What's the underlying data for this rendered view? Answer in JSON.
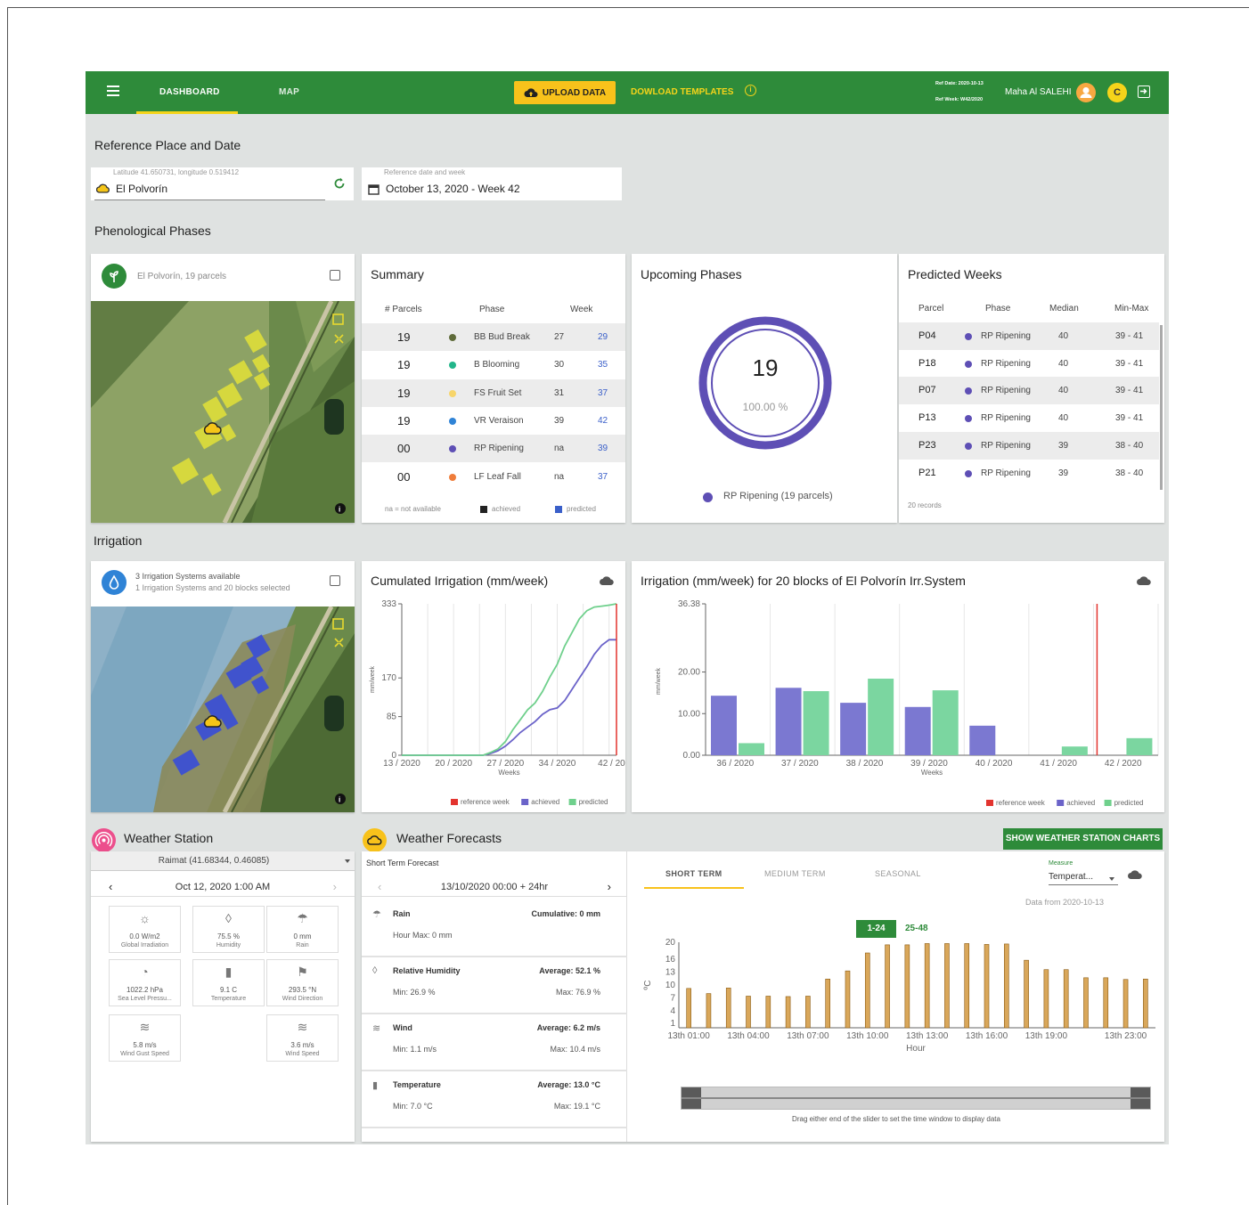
{
  "topbar": {
    "tabs": [
      "DASHBOARD",
      "MAP"
    ],
    "upload_label": "UPLOAD DATA",
    "download_label": "DOWLOAD TEMPLATES",
    "ref_date": "Ref Date: 2020-10-13",
    "ref_week": "Ref Week: W42/2020",
    "user_name": "Maha Al SALEHI",
    "badge": "C"
  },
  "reference": {
    "title": "Reference Place and Date",
    "place_label": "Latitude 41.650731, longitude 0.519412",
    "place_value": "El Polvorín",
    "date_label": "Reference date and week",
    "date_value": "October 13, 2020 - Week 42"
  },
  "phenology": {
    "title": "Phenological Phases",
    "map_caption": "El Polvorín, 19 parcels",
    "summary": {
      "title": "Summary",
      "headers": [
        "# Parcels",
        "Phase",
        "Week"
      ],
      "rows": [
        {
          "parcels": "19",
          "phase": "BB Bud Break",
          "achieved": "27",
          "predicted": "29",
          "color": "#5f6b3a"
        },
        {
          "parcels": "19",
          "phase": "B Blooming",
          "achieved": "30",
          "predicted": "35",
          "color": "#22b58a"
        },
        {
          "parcels": "19",
          "phase": "FS Fruit Set",
          "achieved": "31",
          "predicted": "37",
          "color": "#f7d56b"
        },
        {
          "parcels": "19",
          "phase": "VR Veraison",
          "achieved": "39",
          "predicted": "42",
          "color": "#2f83d6"
        },
        {
          "parcels": "00",
          "phase": "RP Ripening",
          "achieved": "na",
          "predicted": "39",
          "color": "#5e4fb5"
        },
        {
          "parcels": "00",
          "phase": "LF Leaf Fall",
          "achieved": "na",
          "predicted": "37",
          "color": "#ef7d3b"
        }
      ],
      "footer_na": "na = not available",
      "footer_achieved": "achieved",
      "footer_predicted": "predicted"
    },
    "upcoming": {
      "title": "Upcoming Phases",
      "count": "19",
      "percent": "100.00 %",
      "legend": "RP Ripening (19 parcels)",
      "color": "#5e4fb5"
    },
    "predicted": {
      "title": "Predicted Weeks",
      "headers": [
        "Parcel",
        "Phase",
        "Median",
        "Min-Max"
      ],
      "rows": [
        {
          "parcel": "P04",
          "phase": "RP Ripening",
          "median": "40",
          "minmax": "39 - 41"
        },
        {
          "parcel": "P18",
          "phase": "RP Ripening",
          "median": "40",
          "minmax": "39 - 41"
        },
        {
          "parcel": "P07",
          "phase": "RP Ripening",
          "median": "40",
          "minmax": "39 - 41"
        },
        {
          "parcel": "P13",
          "phase": "RP Ripening",
          "median": "40",
          "minmax": "39 - 41"
        },
        {
          "parcel": "P23",
          "phase": "RP Ripening",
          "median": "39",
          "minmax": "38 - 40"
        },
        {
          "parcel": "P21",
          "phase": "RP Ripening",
          "median": "39",
          "minmax": "38 - 40"
        }
      ],
      "footer": "20 records"
    }
  },
  "irrigation": {
    "title": "Irrigation",
    "map_caption_1": "3 Irrigation Systems available",
    "map_caption_2": "1 Irrigation Systems and 20 blocks selected",
    "cumulated_title": "Cumulated Irrigation (mm/week)",
    "blocks_title": "Irrigation (mm/week) for 20 blocks of El Polvorín Irr.System",
    "legend": [
      "reference week",
      "achieved",
      "predicted"
    ]
  },
  "chart_data": [
    {
      "type": "line",
      "title": "Cumulated Irrigation (mm/week)",
      "xlabel": "Weeks",
      "ylabel": "mm/week",
      "x_ticks": [
        "13 / 2020",
        "20 / 2020",
        "27 / 2020",
        "34 / 2020",
        "42 / 2020"
      ],
      "y_ticks": [
        0,
        85,
        170,
        333
      ],
      "xlim": [
        13,
        42
      ],
      "ylim": [
        0,
        333
      ],
      "reference_week": 42,
      "series": [
        {
          "name": "achieved",
          "color": "#6b63c9",
          "x": [
            13,
            24,
            25,
            26,
            27,
            28,
            29,
            30,
            31,
            32,
            33,
            34,
            35,
            36,
            37,
            38,
            39,
            40,
            41,
            42
          ],
          "values": [
            0,
            0,
            4,
            10,
            20,
            34,
            50,
            62,
            74,
            90,
            100,
            104,
            120,
            145,
            170,
            195,
            222,
            242,
            254,
            254
          ]
        },
        {
          "name": "predicted",
          "color": "#6fd08c",
          "x": [
            13,
            24,
            25,
            26,
            27,
            28,
            29,
            30,
            31,
            32,
            33,
            34,
            35,
            36,
            37,
            38,
            39,
            40,
            41,
            42
          ],
          "values": [
            0,
            0,
            6,
            14,
            30,
            56,
            78,
            100,
            115,
            140,
            172,
            200,
            240,
            270,
            300,
            318,
            326,
            328,
            330,
            333
          ]
        }
      ],
      "legend": [
        "reference week",
        "achieved",
        "predicted"
      ]
    },
    {
      "type": "bar",
      "title": "Irrigation (mm/week) for 20 blocks of El Polvorín Irr.System",
      "xlabel": "Weeks",
      "ylabel": "mm/week",
      "categories": [
        "36 / 2020",
        "37 / 2020",
        "38 / 2020",
        "39 / 2020",
        "40 / 2020",
        "41 / 2020",
        "42 / 2020"
      ],
      "y_ticks": [
        "0.00",
        "10.00",
        "20.00",
        "36.38"
      ],
      "ylim": [
        0,
        36.38
      ],
      "reference_week": "42 / 2020",
      "series": [
        {
          "name": "achieved",
          "color": "#7b78d1",
          "values": [
            14.3,
            16.2,
            12.6,
            11.6,
            7.1,
            0,
            0
          ]
        },
        {
          "name": "predicted",
          "color": "#7bd6a0",
          "values": [
            2.9,
            15.4,
            18.4,
            15.6,
            0,
            2.1,
            4.1
          ]
        }
      ],
      "legend": [
        "reference week",
        "achieved",
        "predicted"
      ]
    },
    {
      "type": "bar",
      "title": "",
      "xlabel": "Hour",
      "ylabel": "ºC",
      "y_ticks": [
        1,
        4,
        7,
        10,
        13,
        16,
        20
      ],
      "ylim": [
        0,
        20
      ],
      "x_ticks": [
        "13th 01:00",
        "13th 04:00",
        "13th 07:00",
        "13th 10:00",
        "13th 13:00",
        "13th 16:00",
        "13th 19:00",
        "13th 23:00"
      ],
      "series": [
        {
          "name": "Temperature",
          "color": "#d9a75a",
          "values": [
            9.2,
            8.0,
            9.3,
            7.4,
            7.4,
            7.3,
            7.4,
            11.4,
            13.3,
            17.5,
            19.4,
            19.4,
            19.7,
            19.7,
            19.7,
            19.5,
            19.6,
            15.8,
            13.6,
            13.6,
            11.7,
            11.7,
            11.3,
            11.4
          ]
        }
      ]
    }
  ],
  "weather_station": {
    "title": "Weather Station",
    "station": "Raimat (41.68344, 0.46085)",
    "datetime": "Oct 12, 2020 1:00 AM",
    "items": [
      {
        "value": "0.0 W/m2",
        "name": "Global Irradiation",
        "icon": "sun-icon"
      },
      {
        "value": "75.5 %",
        "name": "Humidity",
        "icon": "drop-icon"
      },
      {
        "value": "0 mm",
        "name": "Rain",
        "icon": "rain-icon"
      },
      {
        "value": "1022.2 hPa",
        "name": "Sea Level Pressu...",
        "icon": "gauge-icon"
      },
      {
        "value": "9.1 C",
        "name": "Temperature",
        "icon": "thermometer-icon"
      },
      {
        "value": "293.5 °N",
        "name": "Wind Direction",
        "icon": "flag-icon"
      },
      {
        "value": "5.8 m/s",
        "name": "Wind Gust Speed",
        "icon": "wind-icon"
      },
      {
        "value": "3.6 m/s",
        "name": "Wind Speed",
        "icon": "wind-icon"
      }
    ]
  },
  "forecast": {
    "title": "Weather Forecasts",
    "subtitle": "Short Term Forecast",
    "range": "13/10/2020 00:00 + 24hr",
    "rows": [
      {
        "name": "Rain",
        "summary": "Cumulative: 0 mm",
        "left": "Hour Max: 0 mm",
        "right": ""
      },
      {
        "name": "Relative Humidity",
        "summary": "Average: 52.1 %",
        "left": "Min: 26.9 %",
        "right": "Max: 76.9 %"
      },
      {
        "name": "Wind",
        "summary": "Average: 6.2 m/s",
        "left": "Min: 1.1 m/s",
        "right": "Max: 10.4 m/s"
      },
      {
        "name": "Temperature",
        "summary": "Average: 13.0 °C",
        "left": "Min: 7.0 °C",
        "right": "Max: 19.1 °C"
      }
    ],
    "show_button": "SHOW WEATHER STATION CHARTS",
    "tabs": [
      "SHORT TERM",
      "MEDIUM TERM",
      "SEASONAL"
    ],
    "measure_label": "Measure",
    "measure_value": "Temperat...",
    "data_from": "Data from 2020-10-13",
    "range_buttons": [
      "1-24",
      "25-48"
    ],
    "slider_caption": "Drag either end of the slider to set the time window to display data"
  }
}
